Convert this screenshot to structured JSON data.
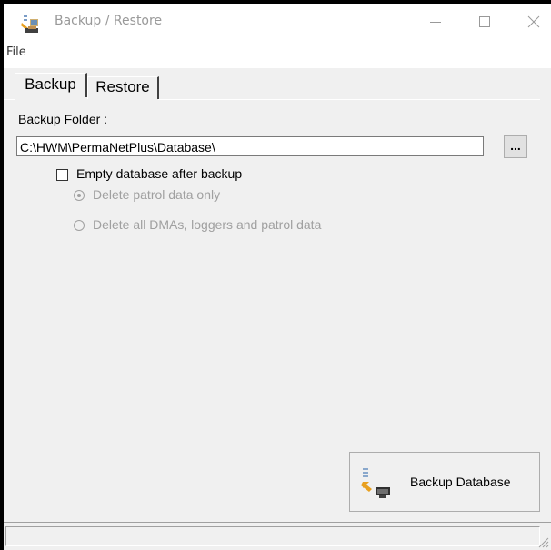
{
  "window": {
    "title": "Backup / Restore"
  },
  "menu": {
    "file_label": "File"
  },
  "tabs": [
    {
      "label": "Backup",
      "selected": true
    },
    {
      "label": "Restore",
      "selected": false
    }
  ],
  "backup": {
    "folder_label": "Backup Folder :",
    "folder_path": "C:\\HWM\\PermaNetPlus\\Database\\",
    "browse_label": "...",
    "empty_db_label": "Empty database after backup",
    "empty_db_checked": false,
    "option_patrol_only": "Delete patrol data only",
    "option_all": "Delete all DMAs, loggers and patrol data",
    "selected_option": "option_patrol_only",
    "backup_button_label": "Backup Database"
  },
  "icons": {
    "app": "backup-restore-app-icon",
    "minimize": "minimize-icon",
    "maximize": "maximize-icon",
    "close": "close-icon",
    "backup_button": "backup-database-icon",
    "grip": "resize-grip-icon"
  }
}
